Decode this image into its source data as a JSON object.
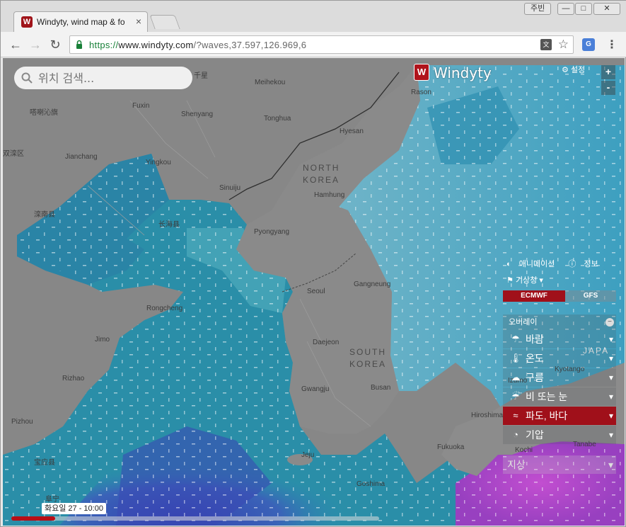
{
  "browser": {
    "tab_title": "Windyty, wind map & fo",
    "tab_favicon_letter": "W",
    "tab_close": "×",
    "user_chip": "주빈",
    "win_min": "—",
    "win_max": "□",
    "win_close": "✕",
    "url_scheme": "https://",
    "url_host": "www.windyty.com",
    "url_rest": "/?waves,37.597,126.969,6",
    "ext_label": "G",
    "translate_label": "文"
  },
  "map": {
    "search_placeholder": "위치 검색...",
    "logo_mark": "W",
    "logo_text": "Windyty",
    "settings_label": "설정",
    "zoom_in": "+",
    "zoom_out": "-",
    "places": [
      {
        "text": "千星",
        "cls": ""
      },
      {
        "text": "Meihekou",
        "cls": ""
      },
      {
        "text": "Fuxin",
        "cls": ""
      },
      {
        "text": "Shenyang",
        "cls": ""
      },
      {
        "text": "Tonghua",
        "cls": ""
      },
      {
        "text": "嗒喇沁旗",
        "cls": ""
      },
      {
        "text": "Hyesan",
        "cls": ""
      },
      {
        "text": "Rason",
        "cls": ""
      },
      {
        "text": "双滦区",
        "cls": ""
      },
      {
        "text": "Jianchang",
        "cls": ""
      },
      {
        "text": "Yingkou",
        "cls": ""
      },
      {
        "text": "NORTH",
        "cls": "big"
      },
      {
        "text": "KOREA",
        "cls": "big"
      },
      {
        "text": "Sinuiju",
        "cls": ""
      },
      {
        "text": "Hamhung",
        "cls": ""
      },
      {
        "text": "滦南县",
        "cls": ""
      },
      {
        "text": "长海县",
        "cls": ""
      },
      {
        "text": "Pyongyang",
        "cls": ""
      },
      {
        "text": "Seoul",
        "cls": ""
      },
      {
        "text": "Gangneung",
        "cls": ""
      },
      {
        "text": "Rongcheng",
        "cls": ""
      },
      {
        "text": "Daejeon",
        "cls": ""
      },
      {
        "text": "SOUTH",
        "cls": "big"
      },
      {
        "text": "KOREA",
        "cls": "big"
      },
      {
        "text": "Jimo",
        "cls": ""
      },
      {
        "text": "Rizhao",
        "cls": ""
      },
      {
        "text": "Gwangju",
        "cls": ""
      },
      {
        "text": "Busan",
        "cls": ""
      },
      {
        "text": "Pizhou",
        "cls": ""
      },
      {
        "text": "宝应县",
        "cls": ""
      },
      {
        "text": "Jeju",
        "cls": ""
      },
      {
        "text": "Goshima",
        "cls": ""
      },
      {
        "text": "JAPA",
        "cls": "big"
      },
      {
        "text": "Kyotango",
        "cls": ""
      },
      {
        "text": "Izumo",
        "cls": ""
      },
      {
        "text": "Hiroshima",
        "cls": ""
      },
      {
        "text": "Fukuoka",
        "cls": ""
      },
      {
        "text": "Kochi",
        "cls": ""
      },
      {
        "text": "Tanabe",
        "cls": ""
      },
      {
        "text": "阜宁",
        "cls": ""
      }
    ]
  },
  "panel": {
    "animation_label": "애니메이션",
    "info_label": "정보",
    "source_label": "기상청",
    "models": [
      "ECMWF",
      "GFS"
    ],
    "overlay_header": "오버레이",
    "overlay_collapse": "−",
    "overlays": [
      {
        "label": "바람",
        "icon": "☂",
        "active": false
      },
      {
        "label": "온도",
        "icon": "🌡",
        "active": false
      },
      {
        "label": "구름",
        "icon": "☁",
        "active": false
      },
      {
        "label": "비 또는 눈",
        "icon": "☔",
        "active": false
      },
      {
        "label": "파도, 바다",
        "icon": "≈",
        "active": true
      },
      {
        "label": "기압",
        "icon": "◔",
        "active": false
      }
    ],
    "overlay_extra": "지상"
  },
  "timeline": {
    "label": "화요일 27 - 10:00",
    "progress": 0.12
  },
  "colors": {
    "accent": "#a0101a",
    "land": "#8a8a8a",
    "sea_teal": "#2a96ad",
    "sea_blue": "#3a57b8",
    "sea_purple": "#b044c4"
  }
}
